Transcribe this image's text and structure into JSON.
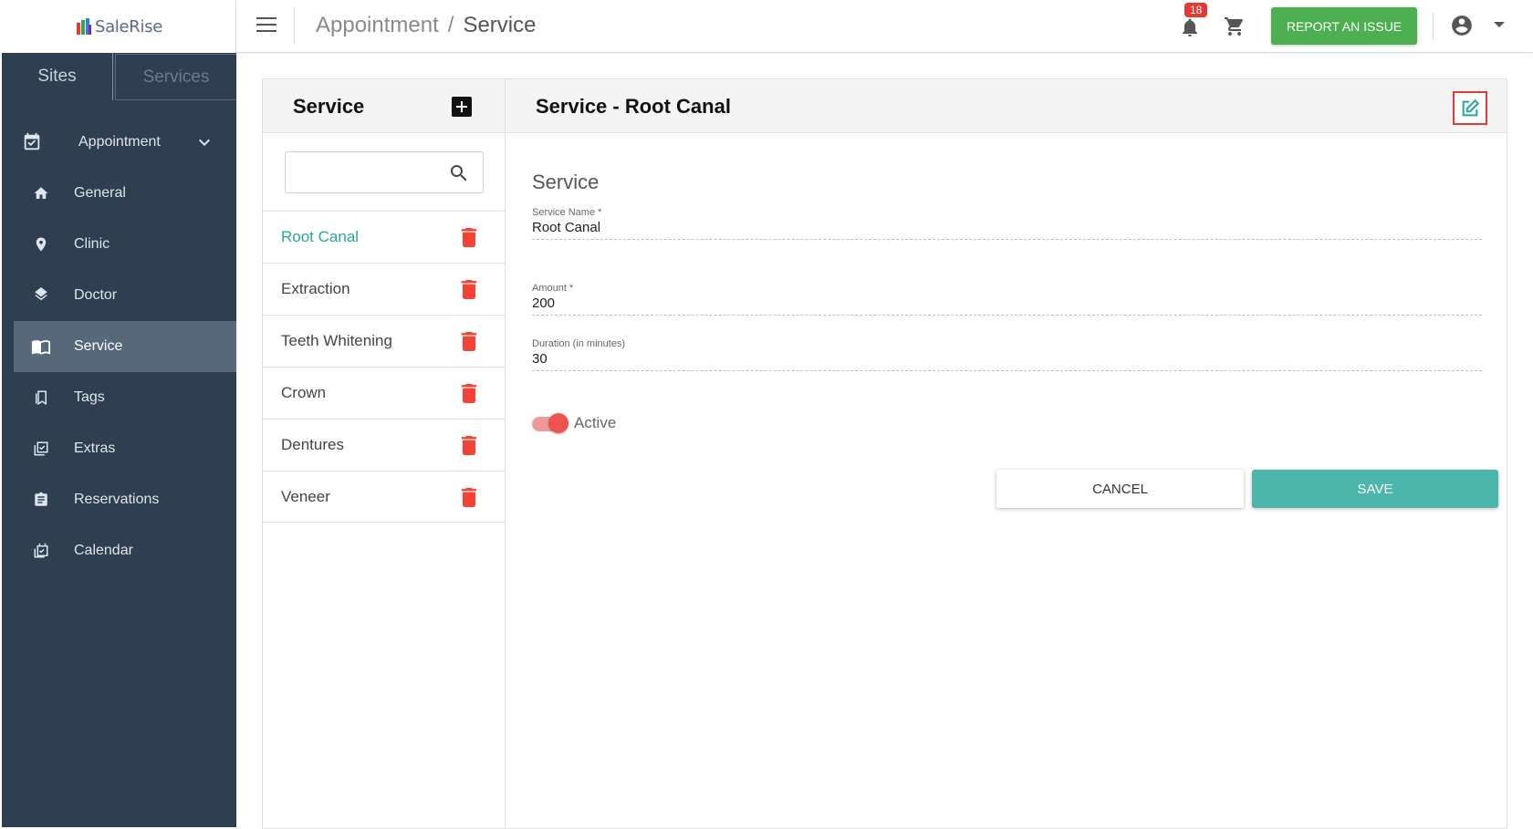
{
  "app": {
    "logo_text": "SaleRise"
  },
  "header": {
    "breadcrumb": {
      "parent": "Appointment",
      "separator": "/",
      "current": "Service"
    },
    "notification_count": "18",
    "report_button": "REPORT AN ISSUE"
  },
  "sidebar": {
    "tabs": {
      "sites": "Sites",
      "services": "Services"
    },
    "section": {
      "label": "Appointment",
      "icon": "calendar-check-icon"
    },
    "items": [
      {
        "label": "General",
        "icon": "home-icon",
        "active": false
      },
      {
        "label": "Clinic",
        "icon": "location-pin-icon",
        "active": false
      },
      {
        "label": "Doctor",
        "icon": "layers-icon",
        "active": false
      },
      {
        "label": "Service",
        "icon": "book-icon",
        "active": true
      },
      {
        "label": "Tags",
        "icon": "bookmark-icon",
        "active": false
      },
      {
        "label": "Extras",
        "icon": "checklist-icon",
        "active": false
      },
      {
        "label": "Reservations",
        "icon": "clipboard-icon",
        "active": false
      },
      {
        "label": "Calendar",
        "icon": "calendar-icon",
        "active": false
      }
    ]
  },
  "list": {
    "title": "Service",
    "search_value": "",
    "items": [
      {
        "name": "Root Canal",
        "selected": true
      },
      {
        "name": "Extraction",
        "selected": false
      },
      {
        "name": "Teeth Whitening",
        "selected": false
      },
      {
        "name": "Crown",
        "selected": false
      },
      {
        "name": "Dentures",
        "selected": false
      },
      {
        "name": "Veneer",
        "selected": false
      }
    ]
  },
  "detail": {
    "title": "Service - Root Canal",
    "section_title": "Service",
    "fields": {
      "service_name": {
        "label": "Service Name *",
        "value": "Root Canal"
      },
      "amount": {
        "label": "Amount *",
        "value": "200"
      },
      "duration": {
        "label": "Duration (in minutes)",
        "value": "30"
      }
    },
    "active_toggle": {
      "label": "Active",
      "on": true
    },
    "cancel_label": "CANCEL",
    "save_label": "SAVE"
  },
  "colors": {
    "sidebar_bg": "#2f3e50",
    "sidebar_active": "#56687a",
    "accent_teal": "#26a69a",
    "save_teal": "#4db6ac",
    "report_green": "#4caf50",
    "delete_red": "#f44336",
    "highlight_red": "#e53935"
  }
}
